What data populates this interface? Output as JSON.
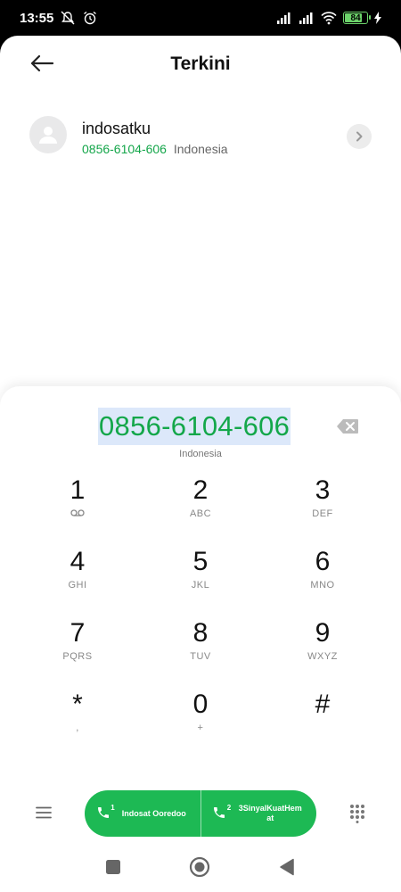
{
  "status_bar": {
    "time": "13:55",
    "battery_level": "84",
    "battery_color": "#6cd36a"
  },
  "header": {
    "title": "Terkini"
  },
  "recent": {
    "name": "indosatku",
    "number": "0856-6104-606",
    "country": "Indonesia"
  },
  "dialer": {
    "number": "0856-6104-606",
    "country": "Indonesia",
    "keys": [
      {
        "digit": "1",
        "letters": ""
      },
      {
        "digit": "2",
        "letters": "ABC"
      },
      {
        "digit": "3",
        "letters": "DEF"
      },
      {
        "digit": "4",
        "letters": "GHI"
      },
      {
        "digit": "5",
        "letters": "JKL"
      },
      {
        "digit": "6",
        "letters": "MNO"
      },
      {
        "digit": "7",
        "letters": "PQRS"
      },
      {
        "digit": "8",
        "letters": "TUV"
      },
      {
        "digit": "9",
        "letters": "WXYZ"
      },
      {
        "digit": "*",
        "letters": ","
      },
      {
        "digit": "0",
        "letters": "+"
      },
      {
        "digit": "#",
        "letters": ""
      }
    ]
  },
  "call_buttons": [
    {
      "sim": "1",
      "label": "Indosat Ooredoo"
    },
    {
      "sim": "2",
      "label": "3SinyalKuatHem at"
    }
  ],
  "colors": {
    "accent_green": "#1db954",
    "number_green": "#13a74a",
    "selection_bg": "#dce8fa"
  }
}
